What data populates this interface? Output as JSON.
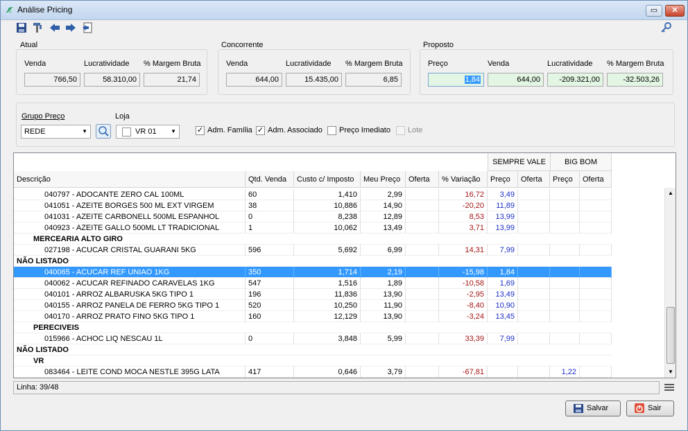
{
  "window": {
    "title": "Análise Pricing",
    "restore_glyph": "▭",
    "close_glyph": "✕"
  },
  "toolbar": [
    "save-icon",
    "tools-icon",
    "arrow-left-icon",
    "arrow-right-icon",
    "export-icon",
    "key-icon"
  ],
  "atual": {
    "title": "Atual",
    "labels": {
      "venda": "Venda",
      "lucr": "Lucratividade",
      "margem": "% Margem Bruta"
    },
    "venda": "766,50",
    "lucr": "58.310,00",
    "margem": "21,74"
  },
  "concorrente": {
    "title": "Concorrente",
    "labels": {
      "venda": "Venda",
      "lucr": "Lucratividade",
      "margem": "% Margem Bruta"
    },
    "venda": "644,00",
    "lucr": "15.435,00",
    "margem": "6,85"
  },
  "proposto": {
    "title": "Proposto",
    "labels": {
      "preco": "Preço",
      "venda": "Venda",
      "lucr": "Lucratividade",
      "margem": "% Margem Bruta"
    },
    "preco": "1,84",
    "venda": "644,00",
    "lucr": "-209.321,00",
    "margem": "-32.503,26"
  },
  "filters": {
    "grupo_label": "Grupo Preço",
    "grupo_value": "REDE",
    "loja_label": "Loja",
    "loja_value": "VR 01",
    "adm_familia": "Adm. Família",
    "adm_associado": "Adm. Associado",
    "preco_imediato": "Preço Imediato",
    "lote": "Lote",
    "checked_glyph": "✓"
  },
  "grid": {
    "group_headers": [
      "SEMPRE VALE",
      "BIG BOM"
    ],
    "columns": [
      "Descrição",
      "Qtd. Venda",
      "Custo c/ Imposto",
      "Meu Preço",
      "Oferta",
      "% Variação",
      "Preço",
      "Oferta",
      "Preço",
      "Oferta"
    ],
    "rows": [
      {
        "desc": "040797 - ADOCANTE ZERO CAL 100ML",
        "qtd": "60",
        "custo": "1,410",
        "preco": "2,99",
        "oferta": "",
        "var": "16,72",
        "sv_preco": "3,49",
        "sv_oferta": "",
        "bb_preco": "",
        "bb_oferta": ""
      },
      {
        "desc": "041051 - AZEITE BORGES 500 ML EXT VIRGEM",
        "qtd": "38",
        "custo": "10,886",
        "preco": "14,90",
        "oferta": "",
        "var": "-20,20",
        "sv_preco": "11,89",
        "sv_oferta": "",
        "bb_preco": "",
        "bb_oferta": ""
      },
      {
        "desc": "041031 - AZEITE CARBONELL 500ML ESPANHOL",
        "qtd": "0",
        "custo": "8,238",
        "preco": "12,89",
        "oferta": "",
        "var": "8,53",
        "sv_preco": "13,99",
        "sv_oferta": "",
        "bb_preco": "",
        "bb_oferta": ""
      },
      {
        "desc": "040923 - AZEITE GALLO 500ML LT TRADICIONAL",
        "qtd": "1",
        "custo": "10,062",
        "preco": "13,49",
        "oferta": "",
        "var": "3,71",
        "sv_preco": "13,99",
        "sv_oferta": "",
        "bb_preco": "",
        "bb_oferta": ""
      },
      {
        "group": "MERCEARIA ALTO GIRO",
        "level": 1
      },
      {
        "desc": "027198 - ACUCAR CRISTAL GUARANI 5KG",
        "qtd": "596",
        "custo": "5,692",
        "preco": "6,99",
        "oferta": "",
        "var": "14,31",
        "sv_preco": "7,99",
        "sv_oferta": "",
        "bb_preco": "",
        "bb_oferta": ""
      },
      {
        "group": "NÃO LISTADO",
        "level": 0
      },
      {
        "desc": "040065 - ACUCAR REF UNIAO 1KG",
        "qtd": "350",
        "custo": "1,714",
        "preco": "2,19",
        "oferta": "",
        "var": "-15,98",
        "sv_preco": "1,84",
        "sv_oferta": "",
        "bb_preco": "",
        "bb_oferta": "",
        "selected": true
      },
      {
        "desc": "040062 - ACUCAR REFINADO CARAVELAS 1KG",
        "qtd": "547",
        "custo": "1,516",
        "preco": "1,89",
        "oferta": "",
        "var": "-10,58",
        "sv_preco": "1,69",
        "sv_oferta": "",
        "bb_preco": "",
        "bb_oferta": ""
      },
      {
        "desc": "040101 - ARROZ ALBARUSKA 5KG TIPO 1",
        "qtd": "196",
        "custo": "11,836",
        "preco": "13,90",
        "oferta": "",
        "var": "-2,95",
        "sv_preco": "13,49",
        "sv_oferta": "",
        "bb_preco": "",
        "bb_oferta": ""
      },
      {
        "desc": "040155 - ARROZ PANELA DE FERRO 5KG TIPO 1",
        "qtd": "520",
        "custo": "10,250",
        "preco": "11,90",
        "oferta": "",
        "var": "-8,40",
        "sv_preco": "10,90",
        "sv_oferta": "",
        "bb_preco": "",
        "bb_oferta": ""
      },
      {
        "desc": "040170 - ARROZ PRATO FINO 5KG TIPO 1",
        "qtd": "160",
        "custo": "12,129",
        "preco": "13,90",
        "oferta": "",
        "var": "-3,24",
        "sv_preco": "13,45",
        "sv_oferta": "",
        "bb_preco": "",
        "bb_oferta": ""
      },
      {
        "group": "PERECIVEIS",
        "level": 1
      },
      {
        "desc": "015966 - ACHOC LIQ NESCAU 1L",
        "qtd": "0",
        "custo": "3,848",
        "preco": "5,99",
        "oferta": "",
        "var": "33,39",
        "sv_preco": "7,99",
        "sv_oferta": "",
        "bb_preco": "",
        "bb_oferta": ""
      },
      {
        "group": "NÃO LISTADO",
        "level": 0
      },
      {
        "group": "VR",
        "level": 1
      },
      {
        "desc": "083464 - LEITE COND MOCA NESTLE 395G  LATA",
        "qtd": "417",
        "custo": "0,646",
        "preco": "3,79",
        "oferta": "",
        "var": "-67,81",
        "sv_preco": "",
        "sv_oferta": "",
        "bb_preco": "1,22",
        "bb_oferta": ""
      }
    ]
  },
  "status": {
    "linha": "Linha: 39/48"
  },
  "buttons": {
    "salvar": "Salvar",
    "sair": "Sair"
  }
}
